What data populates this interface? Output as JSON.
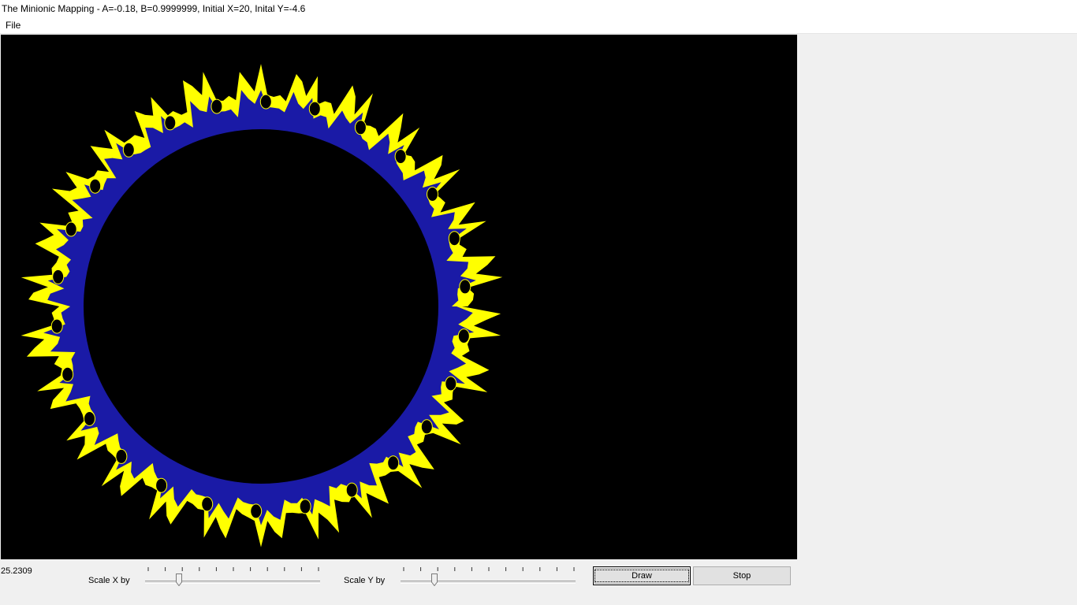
{
  "window": {
    "title": "The Minionic Mapping - A=-0.18, B=0.9999999, Initial X=20, Inital Y=-4.6"
  },
  "menu": {
    "items": [
      {
        "label": "File"
      }
    ]
  },
  "canvas": {
    "background": "#000000",
    "colors": {
      "outer": "#ffff00",
      "inner": "#1a1aa6"
    }
  },
  "status": {
    "value": "25.2309"
  },
  "controls": {
    "scale_x_label": "Scale X by",
    "scale_y_label": "Scale Y by",
    "scale_x_position": 0.18,
    "scale_y_position": 0.18,
    "tick_count": 11,
    "draw_label": "Draw",
    "stop_label": "Stop"
  }
}
